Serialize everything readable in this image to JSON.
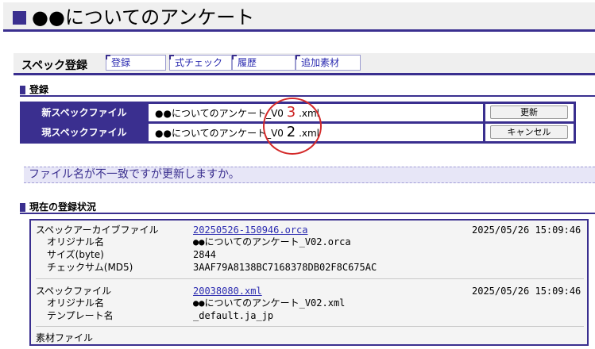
{
  "page": {
    "title": "●●についてのアンケート"
  },
  "nav": {
    "title": "スペック登録",
    "tabs": [
      "登録",
      "式チェック",
      "履歴",
      "追加素材"
    ]
  },
  "register": {
    "section_label": "登録",
    "rows": [
      {
        "label": "新スペックファイル",
        "prefix": "●●についてのアンケート_V0",
        "version": "3",
        "suffix": ".xml",
        "button": "更新"
      },
      {
        "label": "現スペックファイル",
        "prefix": "●●についてのアンケート_V0",
        "version": "2",
        "suffix": ".xml",
        "button": "キャンセル"
      }
    ]
  },
  "warning": "ファイル名が不一致ですが更新しますか。",
  "status": {
    "section_label": "現在の登録状況",
    "archive": {
      "label": "スペックアーカイブファイル",
      "link": "20250526-150946.orca",
      "timestamp": "2025/05/26 15:09:46",
      "fields": [
        {
          "key": "オリジナル名",
          "value": "●●についてのアンケート_V02.orca"
        },
        {
          "key": "サイズ(byte)",
          "value": "2844"
        },
        {
          "key": "チェックサム(MD5)",
          "value": "3AAF79A8138BC7168378DB02F8C675AC"
        }
      ]
    },
    "spec": {
      "label": "スペックファイル",
      "link": "20038080.xml",
      "timestamp": "2025/05/26 15:09:46",
      "fields": [
        {
          "key": "オリジナル名",
          "value": "●●についてのアンケート_V02.xml"
        },
        {
          "key": "テンプレート名",
          "value": "_default.ja_jp"
        }
      ]
    },
    "material_label": "素材ファイル"
  }
}
